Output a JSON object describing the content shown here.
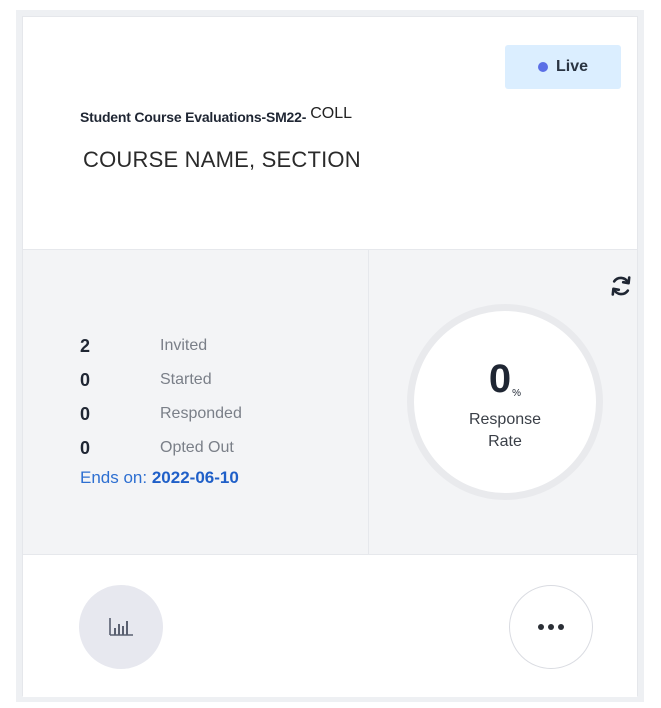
{
  "card": {
    "status": "Live",
    "evaluation_name": "Student Course Evaluations-SM22-",
    "evaluation_suffix": "COLL",
    "course_name": "COURSE NAME, SECTION"
  },
  "stats": {
    "items": [
      {
        "value": "2",
        "label": "Invited"
      },
      {
        "value": "0",
        "label": "Started"
      },
      {
        "value": "0",
        "label": "Responded"
      },
      {
        "value": "0",
        "label": "Opted Out"
      }
    ],
    "ends_label": "Ends on:",
    "ends_date": "2022-06-10"
  },
  "response_rate": {
    "value": "0",
    "unit": "%",
    "label_line1": "Response",
    "label_line2": "Rate"
  },
  "icons": {
    "refresh": "refresh-icon",
    "report": "bar-chart-icon",
    "more": "more-icon"
  },
  "colors": {
    "badge_bg": "#dbeeff",
    "live_dot": "#5b6fe6",
    "link_blue": "#1f5fc8",
    "stats_bg": "#f3f4f6",
    "ring": "#e9eaed"
  }
}
